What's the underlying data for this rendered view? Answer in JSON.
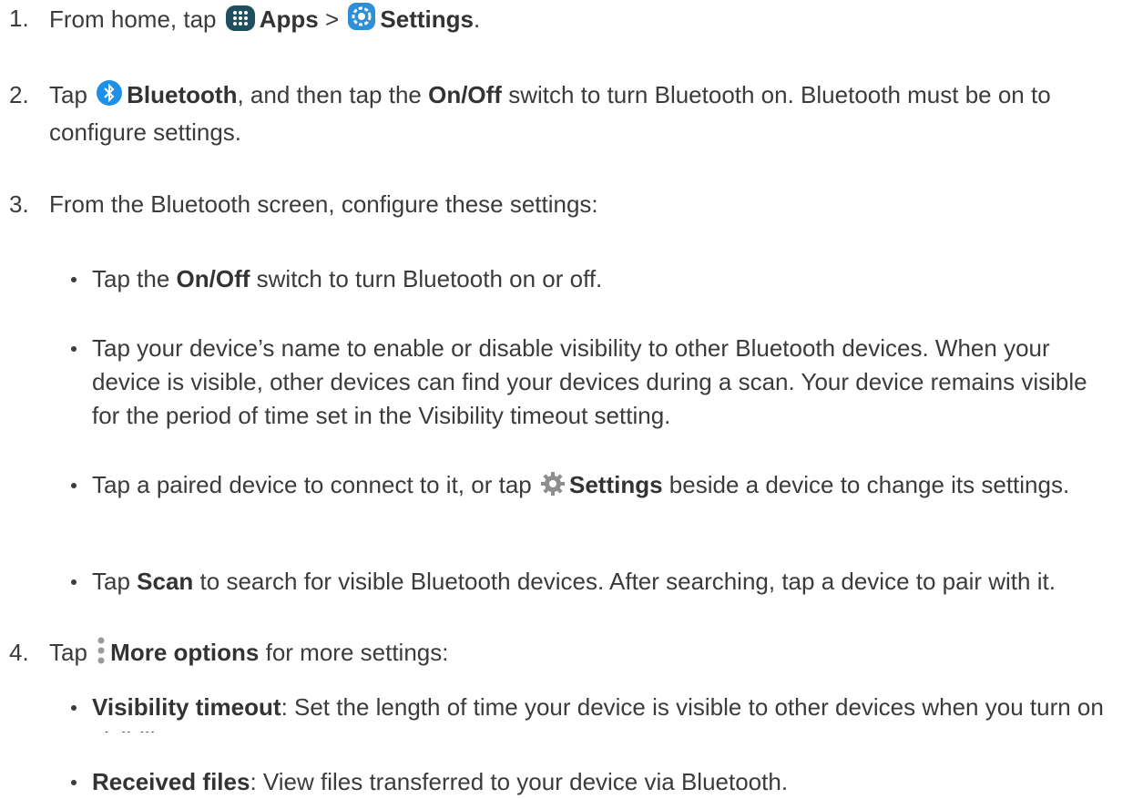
{
  "steps": [
    {
      "num": "1.",
      "pre": "From home, tap",
      "b1": "Apps",
      "sep": ">",
      "b2": "Settings",
      "post": "."
    },
    {
      "num": "2.",
      "pre": "Tap",
      "b1": "Bluetooth",
      "mid": ", and then tap the",
      "b2": "On/Off",
      "post": "switch to turn Bluetooth on. Bluetooth must be on to configure settings."
    },
    {
      "num": "3.",
      "text": "From the Bluetooth screen, configure these settings:"
    },
    {
      "num": "4.",
      "pre": "Tap",
      "b1": "More options",
      "post": "for more settings:"
    }
  ],
  "bullets3": [
    {
      "pre": "Tap the",
      "b": "On/Off",
      "post": "switch to turn Bluetooth on or off."
    },
    {
      "text": "Tap your device’s name to enable or disable visibility to other Bluetooth devices. When your device is visible, other devices can find your devices during a scan. Your device remains visible for the period of time set in the Visibility timeout setting."
    },
    {
      "pre": "Tap a paired device to connect to it, or tap",
      "b": "Settings",
      "post": "beside a device to change its settings."
    },
    {
      "pre": "Tap",
      "b": "Scan",
      "post": "to search for visible Bluetooth devices. After searching, tap a device to pair with it."
    }
  ],
  "bullets4": [
    {
      "b": "Visibility timeout",
      "post": ": Set the length of time your device is visible to other devices when you turn on visibility."
    },
    {
      "b": "Received files",
      "post": ": View files transferred to your device via Bluetooth."
    }
  ],
  "icons": {
    "apps": "apps-grid-icon",
    "settings": "settings-gear-icon",
    "bluetooth": "bluetooth-icon",
    "gear": "gear-icon",
    "more": "more-options-icon"
  },
  "colors": {
    "text": "#3b3b3b",
    "apps_icon": "#1f4e5f",
    "settings_icon": "#2f8fd6",
    "bluetooth_icon": "#1e90e8"
  }
}
